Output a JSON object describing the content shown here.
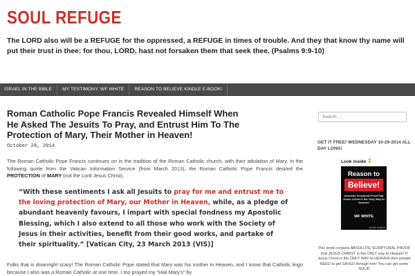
{
  "site": {
    "title": "SOUL REFUGE",
    "tagline": "The LORD also will be a REFUGE for the oppressed, a REFUGE in times of trouble. And they that know thy name will put their trust in thee: for thou, LORD, hast not forsaken them that seek thee. (Psalms 9:9-10)"
  },
  "nav": {
    "items": [
      {
        "label": "ISRAEL IN THE BIBLE"
      },
      {
        "label": "MY TESTIMONY: WF WHITE"
      },
      {
        "label": "REASON TO BELIEVE KINDLE E-BOOK!"
      }
    ]
  },
  "post": {
    "title": "Roman Catholic Pope Francis Revealed Himself When He Asked The Jesuits To Pray, and Entrust Him To The Protection of Mary, Their Mother in Heaven!",
    "date": "October 28, 2014",
    "intro_a": "The Roman Catholic Pope Francis continues on in the tradition of the Roman Catholic church, with their adulation of Mary. In the following quote from the Vatican Information Service (from March 2013), the Roman Catholic Pope Francis desired the ",
    "intro_protection": "PROTECTION",
    "intro_of": " of ",
    "intro_mary": "MARY",
    "intro_b": " (not the Lord Jesus Christ).",
    "quote_a": "“With these sentiments I ask all Jesuits to ",
    "quote_red": "pray for me and entrust me to the loving protection of Mary, our Mother in Heaven,",
    "quote_b": " while, as a pledge of abundant heavenly favours, I impart with special fondness my Apostolic Blessing, which I also extend to all those who work with the Society of Jesus in their activities, benefit from their good works, and partake of their spirituality.” [Vatican City, 23 March 2013 (VIS)]",
    "para2": "Folks that is downright scary! The Roman Catholic Pope stated that Mary was his mother in Heaven, and I know that Catholic lingo because I also was a Roman Catholic at one time. I too prayed my “Hail Mary’s” by"
  },
  "sidebar": {
    "search_placeholder": "Search …",
    "widget_title": "GET IT FREE! WEDNESDAY 10-29-2014 ALL DAY LONG!",
    "look_inside": "Look inside",
    "book": {
      "line1": "Reason to",
      "line2": "Believe!",
      "subtitle": "Absolute Scriptural Proof that Jesus Christ is the Only Way to Heaven!",
      "author": "WF WHITE",
      "kindle": "kindle edition"
    },
    "widget_text": "This book contains ABSOLUTE SCRIPTURAL PROOF that JESUS CHRIST is the ONLY way to Heaven! If Jesus Christ is the ONLY WAY to HEAVEN then people NEED to get SAVED through him! You can get some SOLID"
  },
  "colors": {
    "accent": "#c8312c",
    "nav_bg": "#4a4a4a",
    "sidebar_bg": "#ffffff"
  }
}
